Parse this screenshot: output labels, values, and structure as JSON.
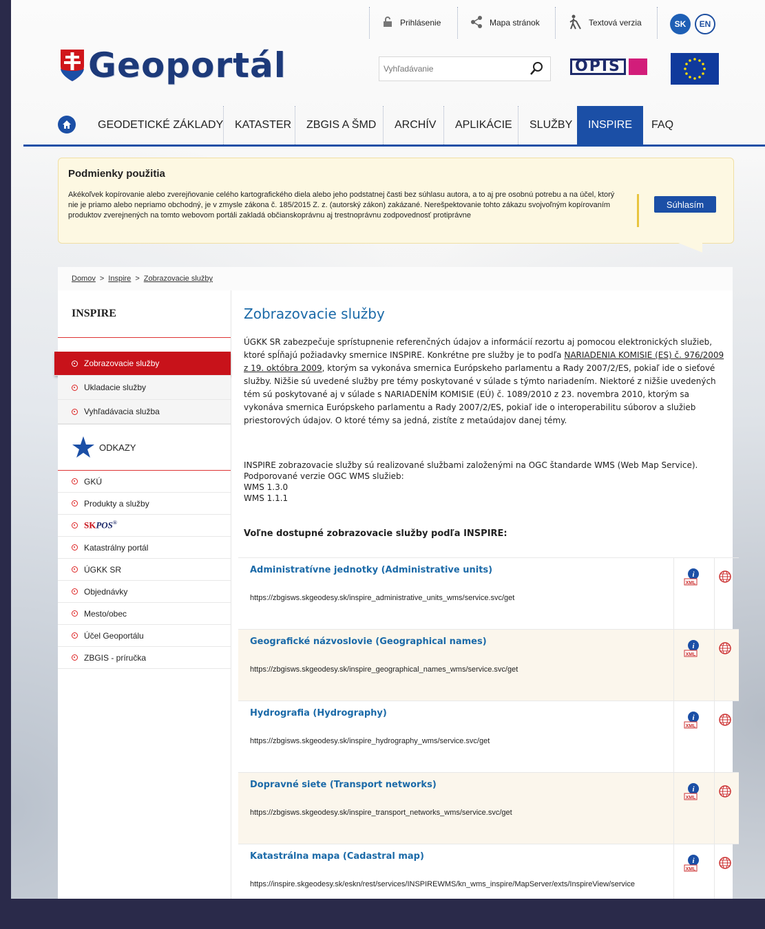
{
  "topbar": {
    "login": "Prihlásenie",
    "sitemap": "Mapa stránok",
    "text_version": "Textová verzia",
    "lang_sk": "SK",
    "lang_en": "EN"
  },
  "header": {
    "logo_text": "Geoportál",
    "search_placeholder": "Vyhľadávanie",
    "opis_text": "OPIS"
  },
  "nav": {
    "items": [
      "GEODETICKÉ ZÁKLADY",
      "KATASTER",
      "ZBGIS A ŠMD",
      "ARCHÍV",
      "APLIKÁCIE",
      "SLUŽBY",
      "INSPIRE",
      "FAQ"
    ],
    "active": "INSPIRE"
  },
  "notice": {
    "title": "Podmienky použitia",
    "text": "Akékoľvek kopírovanie alebo zverejňovanie celého kartografického diela alebo jeho podstatnej časti bez súhlasu autora, a to aj pre osobnú potrebu a na účel, ktorý nie je priamo alebo nepriamo obchodný, je v zmysle zákona č. 185/2015 Z. z. (autorský zákon) zakázané. Nerešpektovanie tohto zákazu svojvoľným kopírovaním produktov zverejnených na tomto webovom portáli zakladá občianskoprávnu aj trestnoprávnu zodpovednosť protiprávne",
    "button": "Súhlasím"
  },
  "breadcrumb": [
    "Domov",
    "Inspire",
    "Zobrazovacie služby"
  ],
  "breadcrumb_sep": ">",
  "sidebar": {
    "title": "INSPIRE",
    "items": [
      "Zobrazovacie služby",
      "Ukladacie služby",
      "Vyhľadávacia služba"
    ],
    "links_title": "ODKAZY",
    "links": [
      "GKÚ",
      "Produkty a služby",
      "SKPOS",
      "Katastrálny portál",
      "ÚGKK SR",
      "Objednávky",
      "Mesto/obec",
      "Účel Geoportálu",
      "ZBGIS - príručka"
    ],
    "skpos": {
      "sk": "SK",
      "pos": "POS",
      "reg": "®"
    }
  },
  "main": {
    "title": "Zobrazovacie služby",
    "p1_a": "ÚGKK SR zabezpečuje sprístupnenie referenčných údajov a informácií rezortu aj pomocou elektronických služieb, ktoré spĺňajú požiadavky smernice INSPIRE. Konkrétne pre služby je to podľa ",
    "p1_link": "NARIADENIA KOMISIE (ES) č. 976/2009 z 19. októbra 2009",
    "p1_b": ", ktorým sa vykonáva smernica Európskeho parlamentu a Rady 2007/2/ES, pokiaľ ide o sieťové služby. Nižšie sú uvedené služby pre témy poskytované v súlade s týmto nariadením. Niektoré z nižšie uvedených tém sú poskytované aj v súlade s NARIADENÍM KOMISIE (EÚ) č. 1089/2010 z 23. novembra 2010, ktorým sa vykonáva smernica Európskeho parlamentu a Rady 2007/2/ES, pokiaľ ide o interoperabilitu súborov a služieb priestorových údajov. O ktoré témy sa jedná, zistíte z metaúdajov danej témy.",
    "p2_line1": "INSPIRE zobrazovacie služby sú realizované službami založenými na OGC štandarde WMS (Web Map Service).",
    "p2_line2": "Podporované verzie OGC WMS služieb:",
    "p2_line3": "WMS 1.3.0",
    "p2_line4": "WMS 1.1.1",
    "services_heading": "Voľne dostupné zobrazovacie služby podľa INSPIRE:"
  },
  "services": [
    {
      "title": "Administratívne jednotky (Administrative units)",
      "url": "https://zbgisws.skgeodesy.sk/inspire_administrative_units_wms/service.svc/get"
    },
    {
      "title": "Geografické názvoslovie (Geographical names)",
      "url": "https://zbgisws.skgeodesy.sk/inspire_geographical_names_wms/service.svc/get"
    },
    {
      "title": "Hydrografia (Hydrography)",
      "url": "https://zbgisws.skgeodesy.sk/inspire_hydrography_wms/service.svc/get"
    },
    {
      "title": "Dopravné siete (Transport networks)",
      "url": "https://zbgisws.skgeodesy.sk/inspire_transport_networks_wms/service.svc/get"
    },
    {
      "title": "Katastrálna mapa (Cadastral map)",
      "url": "https://inspire.skgeodesy.sk/eskn/rest/services/INSPIREWMS/kn_wms_inspire/MapServer/exts/InspireView/service"
    }
  ],
  "icons": {
    "lock": "lock-icon",
    "share": "share-icon",
    "walker": "accessibility-icon",
    "search": "search-icon",
    "home": "home-icon",
    "star": "star-icon",
    "xml": "xml-metadata-icon",
    "globe": "globe-icon"
  },
  "colors": {
    "brand_blue": "#1b4fa6",
    "active_red": "#c8121a",
    "link_blue": "#1b6aa8",
    "notice_bg": "#fdf8e2"
  }
}
